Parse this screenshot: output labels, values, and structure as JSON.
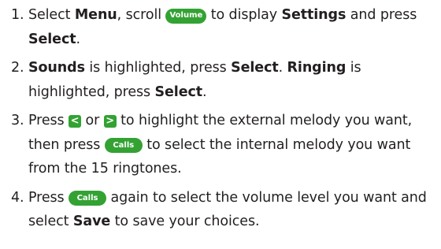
{
  "colors": {
    "accent": "#33a233",
    "text": "#231f20"
  },
  "steps": [
    {
      "number": "1.",
      "segments": [
        {
          "type": "text",
          "text": "Select "
        },
        {
          "type": "bold",
          "text": "Menu"
        },
        {
          "type": "text",
          "text": ", scroll "
        },
        {
          "type": "pill",
          "text": "Volume",
          "icon": "volume-key-icon"
        },
        {
          "type": "text",
          "text": " to display "
        },
        {
          "type": "bold",
          "text": "Settings"
        },
        {
          "type": "text",
          "text": " and press "
        },
        {
          "type": "bold",
          "text": "Select"
        },
        {
          "type": "text",
          "text": "."
        }
      ]
    },
    {
      "number": "2.",
      "segments": [
        {
          "type": "bold",
          "text": "Sounds"
        },
        {
          "type": "text",
          "text": " is highlighted, press "
        },
        {
          "type": "bold",
          "text": "Select"
        },
        {
          "type": "text",
          "text": ". "
        },
        {
          "type": "bold",
          "text": "Ringing"
        },
        {
          "type": "text",
          "text": " is highlighted, press "
        },
        {
          "type": "bold",
          "text": "Select"
        },
        {
          "type": "text",
          "text": "."
        }
      ]
    },
    {
      "number": "3.",
      "segments": [
        {
          "type": "text",
          "text": "Press "
        },
        {
          "type": "key",
          "text": "<",
          "icon": "left-arrow-key-icon"
        },
        {
          "type": "text",
          "text": " or "
        },
        {
          "type": "key",
          "text": ">",
          "icon": "right-arrow-key-icon"
        },
        {
          "type": "text",
          "text": " to highlight the external melody you want, then press "
        },
        {
          "type": "pill",
          "text": "Calls",
          "icon": "calls-key-icon"
        },
        {
          "type": "text",
          "text": " to select the internal melody you want from the 15 ringtones."
        }
      ]
    },
    {
      "number": "4.",
      "segments": [
        {
          "type": "text",
          "text": "Press "
        },
        {
          "type": "pill",
          "text": "Calls",
          "icon": "calls-key-icon"
        },
        {
          "type": "text",
          "text": " again to select the volume level you want and select "
        },
        {
          "type": "bold",
          "text": "Save"
        },
        {
          "type": "text",
          "text": " to save your choices."
        }
      ]
    }
  ]
}
